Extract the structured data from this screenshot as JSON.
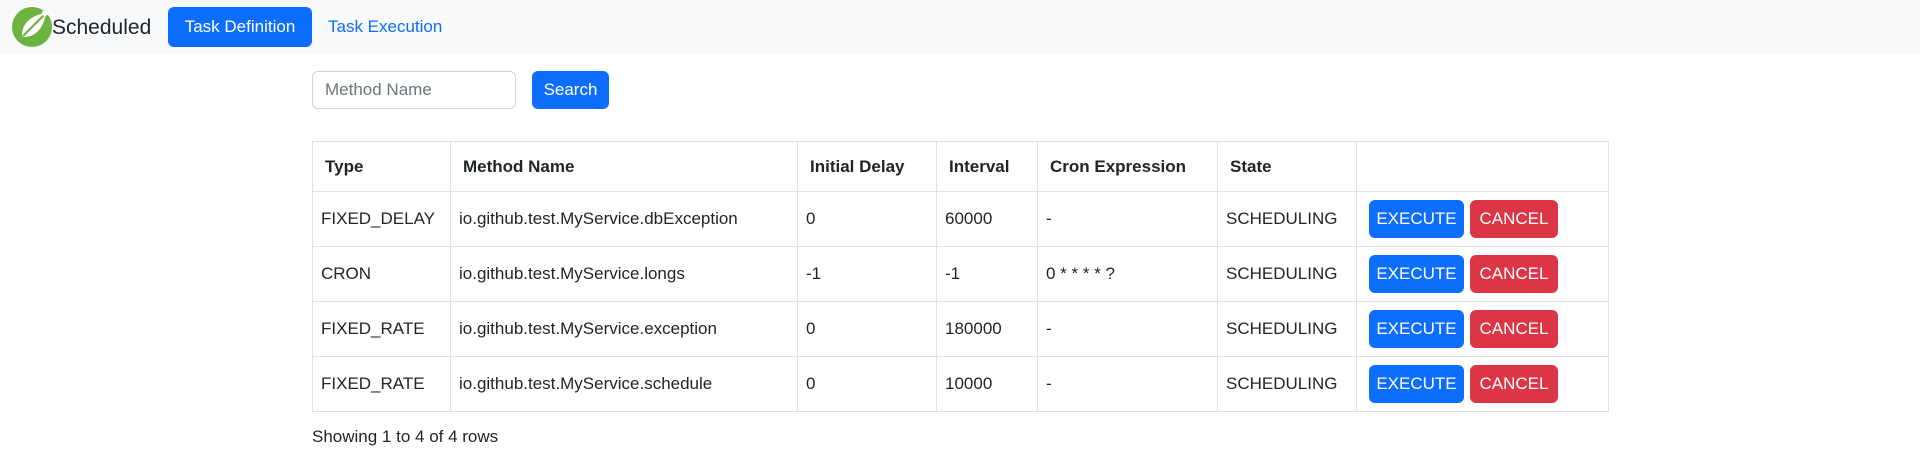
{
  "navbar": {
    "brand_text": "Scheduled",
    "logo_icon": "spring-leaf-icon",
    "tabs": [
      {
        "label": "Task Definition",
        "active": true
      },
      {
        "label": "Task Execution",
        "active": false
      }
    ]
  },
  "search": {
    "placeholder": "Method Name",
    "value": "",
    "button_label": "Search"
  },
  "table": {
    "headers": [
      "Type",
      "Method Name",
      "Initial Delay",
      "Interval",
      "Cron Expression",
      "State",
      ""
    ],
    "rows": [
      {
        "type": "FIXED_DELAY",
        "method": "io.github.test.MyService.dbException",
        "initial_delay": "0",
        "interval": "60000",
        "cron": "-",
        "state": "SCHEDULING",
        "execute_label": "EXECUTE",
        "cancel_label": "CANCEL"
      },
      {
        "type": "CRON",
        "method": "io.github.test.MyService.longs",
        "initial_delay": "-1",
        "interval": "-1",
        "cron": "0 * * * * ?",
        "state": "SCHEDULING",
        "execute_label": "EXECUTE",
        "cancel_label": "CANCEL"
      },
      {
        "type": "FIXED_RATE",
        "method": "io.github.test.MyService.exception",
        "initial_delay": "0",
        "interval": "180000",
        "cron": "-",
        "state": "SCHEDULING",
        "execute_label": "EXECUTE",
        "cancel_label": "CANCEL"
      },
      {
        "type": "FIXED_RATE",
        "method": "io.github.test.MyService.schedule",
        "initial_delay": "0",
        "interval": "10000",
        "cron": "-",
        "state": "SCHEDULING",
        "execute_label": "EXECUTE",
        "cancel_label": "CANCEL"
      }
    ]
  },
  "pagination": {
    "summary": "Showing 1 to 4 of 4 rows"
  },
  "colors": {
    "primary": "#0d6efd",
    "danger": "#dc3545",
    "navbar_bg": "#f8f9fa",
    "logo_green": "#6db33f"
  }
}
